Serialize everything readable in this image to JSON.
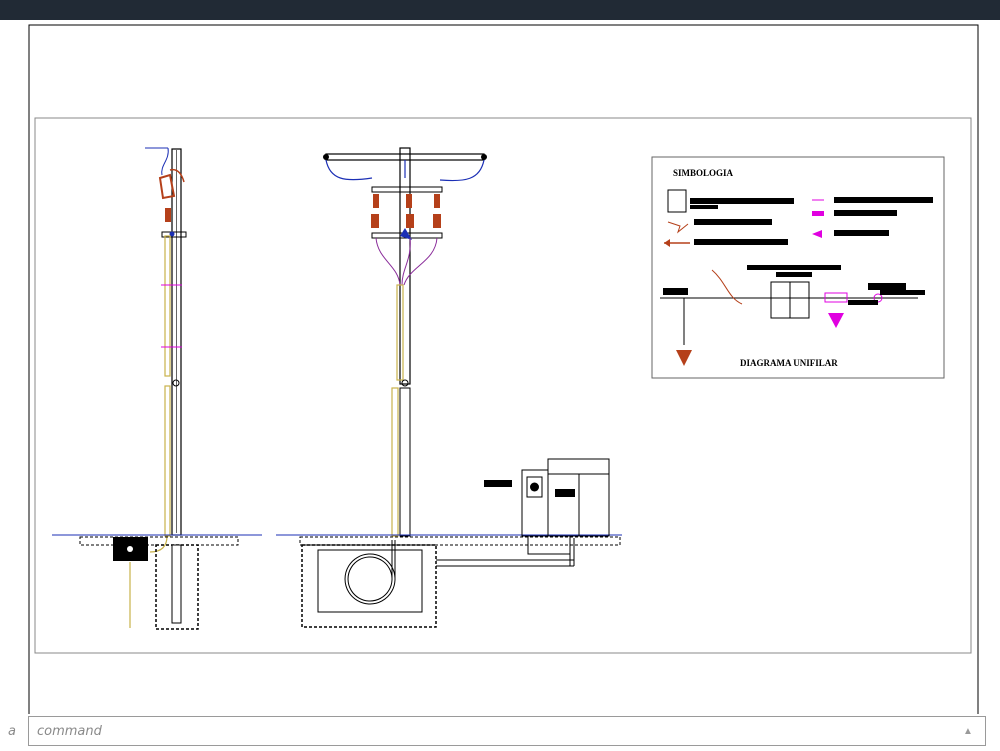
{
  "drawing": {
    "legend_title": "SIMBOLOGIA",
    "diagram_title": "DIAGRAMA UNIFILAR"
  },
  "command_line": {
    "prefix": "a",
    "placeholder": "command",
    "scroll_glyph": "▲"
  },
  "colors": {
    "titlebar": "#212a35",
    "line": "#000000",
    "equipment": "#b5401a",
    "cable": "#1b2fb5",
    "conduit": "#c9b24a",
    "grounding": "#e000e0"
  }
}
